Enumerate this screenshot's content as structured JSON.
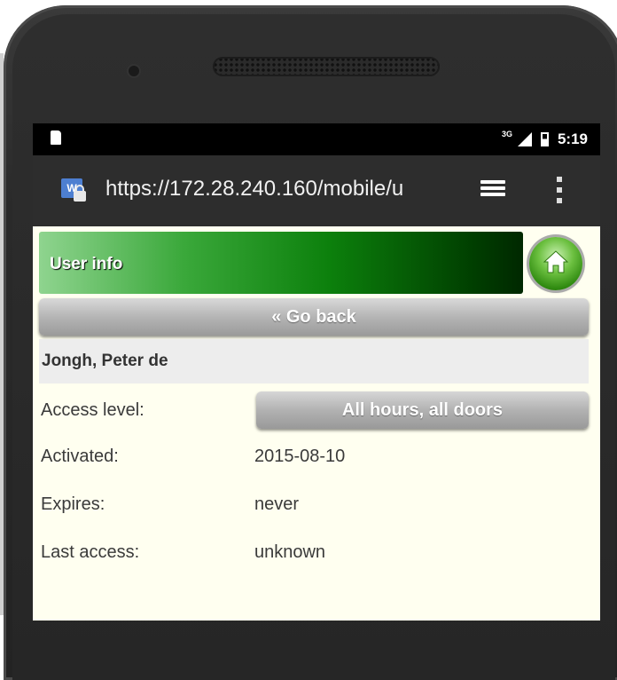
{
  "status_bar": {
    "network_label": "3G",
    "time": "5:19"
  },
  "browser": {
    "url": "https://172.28.240.160/mobile/u",
    "site_icon_letter": "W"
  },
  "page": {
    "header_title": "User info",
    "back_button_label": "« Go back",
    "user_name": "Jongh, Peter de",
    "fields": {
      "access_level_label": "Access level:",
      "access_level_value": "All hours, all doors",
      "activated_label": "Activated:",
      "activated_value": "2015-08-10",
      "expires_label": "Expires:",
      "expires_value": "never",
      "last_access_label": "Last access:",
      "last_access_value": "unknown"
    }
  },
  "colors": {
    "header_gradient_start": "#8fd48f",
    "header_gradient_end": "#002800",
    "page_background": "#fffff0",
    "button_gray": "#b5b5b5"
  },
  "icons": {
    "home": "home-icon",
    "tabs": "tabs-icon",
    "menu": "overflow-menu-icon",
    "lock": "lock-icon"
  }
}
